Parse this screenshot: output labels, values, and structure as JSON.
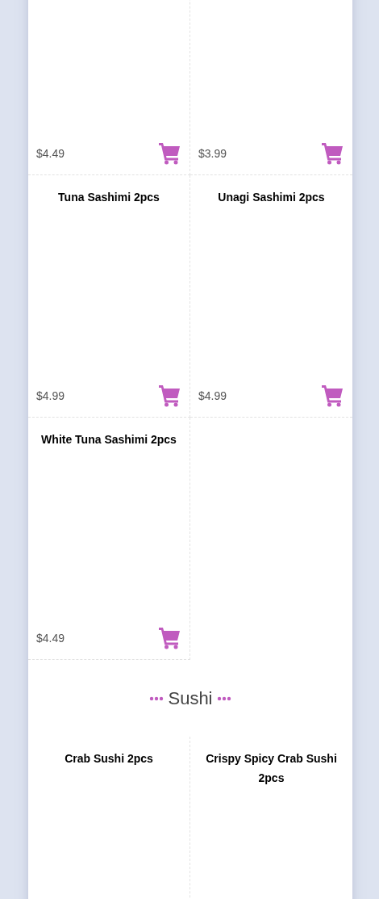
{
  "sections": [
    {
      "items": [
        {
          "price": "$4.49"
        },
        {
          "price": "$3.99"
        },
        {
          "title": "Tuna Sashimi 2pcs",
          "price": "$4.99"
        },
        {
          "title": "Unagi Sashimi 2pcs",
          "price": "$4.99"
        },
        {
          "title": "White Tuna Sashimi 2pcs",
          "price": "$4.49"
        }
      ]
    },
    {
      "title": "Sushi",
      "items": [
        {
          "title": "Crab Sushi 2pcs"
        },
        {
          "title": "Crispy Spicy Crab Sushi 2pcs"
        }
      ]
    }
  ]
}
